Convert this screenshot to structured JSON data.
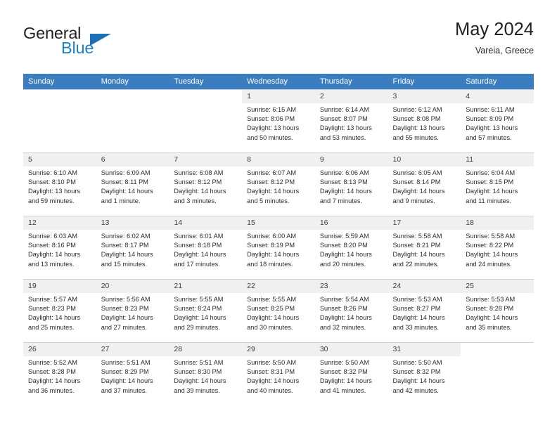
{
  "brand": {
    "name_part1": "General",
    "name_part2": "Blue",
    "triangle_color": "#1b6fb5",
    "blue_color": "#1f7fc6"
  },
  "header": {
    "title": "May 2024",
    "subtitle": "Vareia, Greece",
    "header_bg": "#3a7dc0"
  },
  "weekday_headers": [
    "Sunday",
    "Monday",
    "Tuesday",
    "Wednesday",
    "Thursday",
    "Friday",
    "Saturday"
  ],
  "labels": {
    "sunrise_prefix": "Sunrise:",
    "sunset_prefix": "Sunset:",
    "daylight_prefix": "Daylight:"
  },
  "weeks": [
    [
      {
        "day": "",
        "sunrise": "",
        "sunset": "",
        "daylight_line1": "",
        "daylight_line2": ""
      },
      {
        "day": "",
        "sunrise": "",
        "sunset": "",
        "daylight_line1": "",
        "daylight_line2": ""
      },
      {
        "day": "",
        "sunrise": "",
        "sunset": "",
        "daylight_line1": "",
        "daylight_line2": ""
      },
      {
        "day": "1",
        "sunrise": "Sunrise: 6:15 AM",
        "sunset": "Sunset: 8:06 PM",
        "daylight_line1": "Daylight: 13 hours",
        "daylight_line2": "and 50 minutes."
      },
      {
        "day": "2",
        "sunrise": "Sunrise: 6:14 AM",
        "sunset": "Sunset: 8:07 PM",
        "daylight_line1": "Daylight: 13 hours",
        "daylight_line2": "and 53 minutes."
      },
      {
        "day": "3",
        "sunrise": "Sunrise: 6:12 AM",
        "sunset": "Sunset: 8:08 PM",
        "daylight_line1": "Daylight: 13 hours",
        "daylight_line2": "and 55 minutes."
      },
      {
        "day": "4",
        "sunrise": "Sunrise: 6:11 AM",
        "sunset": "Sunset: 8:09 PM",
        "daylight_line1": "Daylight: 13 hours",
        "daylight_line2": "and 57 minutes."
      }
    ],
    [
      {
        "day": "5",
        "sunrise": "Sunrise: 6:10 AM",
        "sunset": "Sunset: 8:10 PM",
        "daylight_line1": "Daylight: 13 hours",
        "daylight_line2": "and 59 minutes."
      },
      {
        "day": "6",
        "sunrise": "Sunrise: 6:09 AM",
        "sunset": "Sunset: 8:11 PM",
        "daylight_line1": "Daylight: 14 hours",
        "daylight_line2": "and 1 minute."
      },
      {
        "day": "7",
        "sunrise": "Sunrise: 6:08 AM",
        "sunset": "Sunset: 8:12 PM",
        "daylight_line1": "Daylight: 14 hours",
        "daylight_line2": "and 3 minutes."
      },
      {
        "day": "8",
        "sunrise": "Sunrise: 6:07 AM",
        "sunset": "Sunset: 8:12 PM",
        "daylight_line1": "Daylight: 14 hours",
        "daylight_line2": "and 5 minutes."
      },
      {
        "day": "9",
        "sunrise": "Sunrise: 6:06 AM",
        "sunset": "Sunset: 8:13 PM",
        "daylight_line1": "Daylight: 14 hours",
        "daylight_line2": "and 7 minutes."
      },
      {
        "day": "10",
        "sunrise": "Sunrise: 6:05 AM",
        "sunset": "Sunset: 8:14 PM",
        "daylight_line1": "Daylight: 14 hours",
        "daylight_line2": "and 9 minutes."
      },
      {
        "day": "11",
        "sunrise": "Sunrise: 6:04 AM",
        "sunset": "Sunset: 8:15 PM",
        "daylight_line1": "Daylight: 14 hours",
        "daylight_line2": "and 11 minutes."
      }
    ],
    [
      {
        "day": "12",
        "sunrise": "Sunrise: 6:03 AM",
        "sunset": "Sunset: 8:16 PM",
        "daylight_line1": "Daylight: 14 hours",
        "daylight_line2": "and 13 minutes."
      },
      {
        "day": "13",
        "sunrise": "Sunrise: 6:02 AM",
        "sunset": "Sunset: 8:17 PM",
        "daylight_line1": "Daylight: 14 hours",
        "daylight_line2": "and 15 minutes."
      },
      {
        "day": "14",
        "sunrise": "Sunrise: 6:01 AM",
        "sunset": "Sunset: 8:18 PM",
        "daylight_line1": "Daylight: 14 hours",
        "daylight_line2": "and 17 minutes."
      },
      {
        "day": "15",
        "sunrise": "Sunrise: 6:00 AM",
        "sunset": "Sunset: 8:19 PM",
        "daylight_line1": "Daylight: 14 hours",
        "daylight_line2": "and 18 minutes."
      },
      {
        "day": "16",
        "sunrise": "Sunrise: 5:59 AM",
        "sunset": "Sunset: 8:20 PM",
        "daylight_line1": "Daylight: 14 hours",
        "daylight_line2": "and 20 minutes."
      },
      {
        "day": "17",
        "sunrise": "Sunrise: 5:58 AM",
        "sunset": "Sunset: 8:21 PM",
        "daylight_line1": "Daylight: 14 hours",
        "daylight_line2": "and 22 minutes."
      },
      {
        "day": "18",
        "sunrise": "Sunrise: 5:58 AM",
        "sunset": "Sunset: 8:22 PM",
        "daylight_line1": "Daylight: 14 hours",
        "daylight_line2": "and 24 minutes."
      }
    ],
    [
      {
        "day": "19",
        "sunrise": "Sunrise: 5:57 AM",
        "sunset": "Sunset: 8:23 PM",
        "daylight_line1": "Daylight: 14 hours",
        "daylight_line2": "and 25 minutes."
      },
      {
        "day": "20",
        "sunrise": "Sunrise: 5:56 AM",
        "sunset": "Sunset: 8:23 PM",
        "daylight_line1": "Daylight: 14 hours",
        "daylight_line2": "and 27 minutes."
      },
      {
        "day": "21",
        "sunrise": "Sunrise: 5:55 AM",
        "sunset": "Sunset: 8:24 PM",
        "daylight_line1": "Daylight: 14 hours",
        "daylight_line2": "and 29 minutes."
      },
      {
        "day": "22",
        "sunrise": "Sunrise: 5:55 AM",
        "sunset": "Sunset: 8:25 PM",
        "daylight_line1": "Daylight: 14 hours",
        "daylight_line2": "and 30 minutes."
      },
      {
        "day": "23",
        "sunrise": "Sunrise: 5:54 AM",
        "sunset": "Sunset: 8:26 PM",
        "daylight_line1": "Daylight: 14 hours",
        "daylight_line2": "and 32 minutes."
      },
      {
        "day": "24",
        "sunrise": "Sunrise: 5:53 AM",
        "sunset": "Sunset: 8:27 PM",
        "daylight_line1": "Daylight: 14 hours",
        "daylight_line2": "and 33 minutes."
      },
      {
        "day": "25",
        "sunrise": "Sunrise: 5:53 AM",
        "sunset": "Sunset: 8:28 PM",
        "daylight_line1": "Daylight: 14 hours",
        "daylight_line2": "and 35 minutes."
      }
    ],
    [
      {
        "day": "26",
        "sunrise": "Sunrise: 5:52 AM",
        "sunset": "Sunset: 8:28 PM",
        "daylight_line1": "Daylight: 14 hours",
        "daylight_line2": "and 36 minutes."
      },
      {
        "day": "27",
        "sunrise": "Sunrise: 5:51 AM",
        "sunset": "Sunset: 8:29 PM",
        "daylight_line1": "Daylight: 14 hours",
        "daylight_line2": "and 37 minutes."
      },
      {
        "day": "28",
        "sunrise": "Sunrise: 5:51 AM",
        "sunset": "Sunset: 8:30 PM",
        "daylight_line1": "Daylight: 14 hours",
        "daylight_line2": "and 39 minutes."
      },
      {
        "day": "29",
        "sunrise": "Sunrise: 5:50 AM",
        "sunset": "Sunset: 8:31 PM",
        "daylight_line1": "Daylight: 14 hours",
        "daylight_line2": "and 40 minutes."
      },
      {
        "day": "30",
        "sunrise": "Sunrise: 5:50 AM",
        "sunset": "Sunset: 8:32 PM",
        "daylight_line1": "Daylight: 14 hours",
        "daylight_line2": "and 41 minutes."
      },
      {
        "day": "31",
        "sunrise": "Sunrise: 5:50 AM",
        "sunset": "Sunset: 8:32 PM",
        "daylight_line1": "Daylight: 14 hours",
        "daylight_line2": "and 42 minutes."
      },
      {
        "day": "",
        "sunrise": "",
        "sunset": "",
        "daylight_line1": "",
        "daylight_line2": ""
      }
    ]
  ]
}
